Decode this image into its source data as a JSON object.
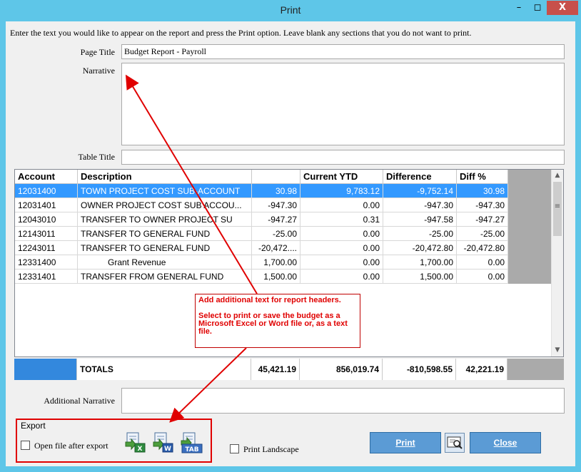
{
  "window": {
    "title": "Print",
    "min": "–",
    "max": "◻",
    "close": "X"
  },
  "instructions": "Enter the text you would like to appear on the report and press the Print option. Leave blank any sections that you do not want to print.",
  "form": {
    "page_title_label": "Page Title",
    "page_title_value": "Budget Report - Payroll",
    "narrative_label": "Narrative",
    "narrative_value": "",
    "table_title_label": "Table Title",
    "table_title_value": "",
    "additional_narrative_label": "Additional Narrative",
    "additional_narrative_value": ""
  },
  "table": {
    "columns": [
      "Account",
      "Description",
      "",
      "Current YTD",
      "Difference",
      "Diff %"
    ],
    "rows": [
      [
        "12031400",
        "TOWN PROJECT COST SUB-ACCOUNT",
        "30.98",
        "9,783.12",
        "-9,752.14",
        "30.98"
      ],
      [
        "12031401",
        "OWNER PROJECT COST SUB ACCOU...",
        "-947.30",
        "0.00",
        "-947.30",
        "-947.30"
      ],
      [
        "12043010",
        "TRANSFER TO OWNER PROJECT SU",
        "-947.27",
        "0.31",
        "-947.58",
        "-947.27"
      ],
      [
        "12143011",
        "TRANSFER TO GENERAL FUND",
        "-25.00",
        "0.00",
        "-25.00",
        "-25.00"
      ],
      [
        "12243011",
        "TRANSFER TO GENERAL FUND",
        "-20,472....",
        "0.00",
        "-20,472.80",
        "-20,472.80"
      ],
      [
        "12331400",
        "Grant Revenue",
        "1,700.00",
        "0.00",
        "1,700.00",
        "0.00"
      ],
      [
        "12331401",
        "TRANSFER FROM GENERAL FUND",
        "1,500.00",
        "0.00",
        "1,500.00",
        "0.00"
      ]
    ],
    "selected_row": 0,
    "totals": {
      "label": "TOTALS",
      "c3": "45,421.19",
      "c4": "856,019.74",
      "c5": "-810,598.55",
      "c6": "42,221.19"
    }
  },
  "export": {
    "group_label": "Export",
    "open_after_label": "Open file after export",
    "open_after_checked": false,
    "icons": [
      "excel-export-icon",
      "word-export-icon",
      "tab-export-icon"
    ],
    "icon_tags": {
      "excel": "X",
      "word": "W",
      "tab": "TAB"
    }
  },
  "print_landscape_label": "Print Landscape",
  "print_landscape_checked": false,
  "buttons": {
    "print": "Print",
    "close": "Close"
  },
  "callout": {
    "line1": "Add additional text for report headers.",
    "line2": "Select to print or save the budget as a Microsoft Excel or Word file or, as a text file."
  },
  "colors": {
    "titlebar": "#5ec6e8",
    "selection": "#3399ff",
    "button": "#5b9bd5",
    "annotation": "#e00000"
  }
}
